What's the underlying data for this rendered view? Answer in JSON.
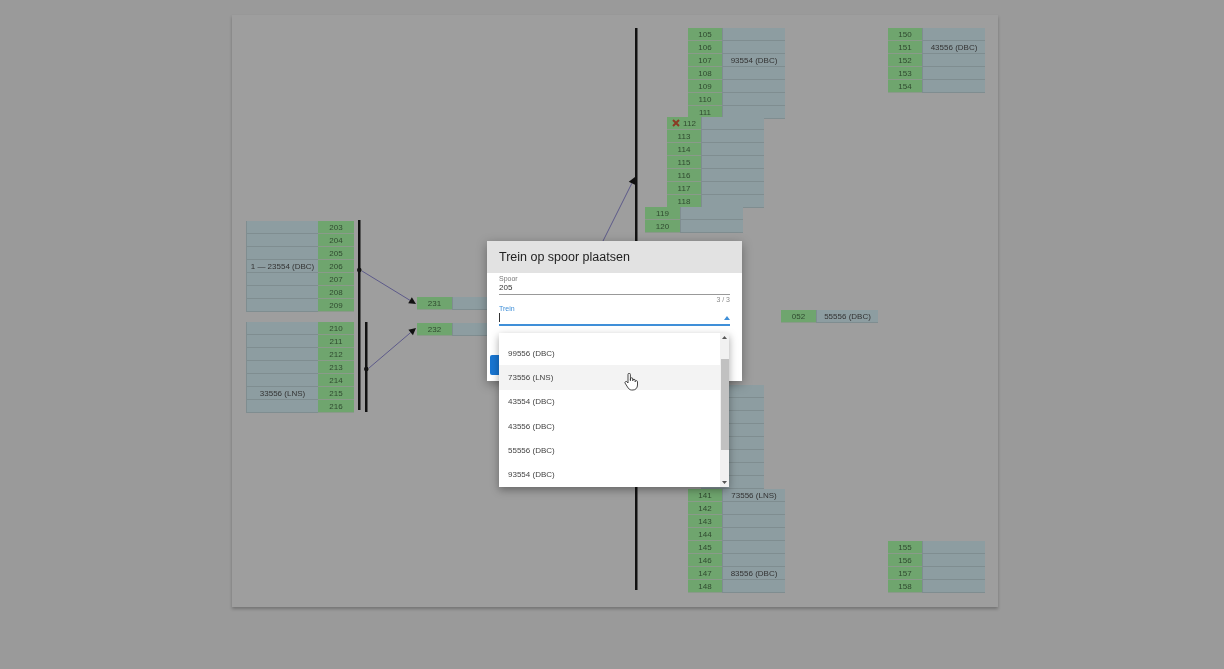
{
  "track_groups": [
    {
      "kind": "left",
      "tracks": [
        {
          "number": "203",
          "blocked": false
        },
        {
          "number": "204",
          "blocked": false
        },
        {
          "number": "205",
          "blocked": false
        },
        {
          "number": "206",
          "train": "1 — 23554 (DBC)",
          "blocked": false
        },
        {
          "number": "207",
          "blocked": false
        },
        {
          "number": "208",
          "blocked": false
        },
        {
          "number": "209",
          "blocked": false
        }
      ]
    },
    {
      "kind": "left",
      "tracks": [
        {
          "number": "210",
          "blocked": false
        },
        {
          "number": "211",
          "blocked": false
        },
        {
          "number": "212",
          "blocked": false
        },
        {
          "number": "213",
          "blocked": false
        },
        {
          "number": "214",
          "blocked": false
        },
        {
          "number": "215",
          "train": "33556 (LNS)",
          "blocked": false
        },
        {
          "number": "216",
          "blocked": false
        }
      ]
    },
    {
      "kind": "right",
      "tracks": [
        {
          "number": "231",
          "blocked": false
        }
      ]
    },
    {
      "kind": "right",
      "tracks": [
        {
          "number": "232",
          "blocked": false
        }
      ]
    },
    {
      "kind": "right",
      "tracks": [
        {
          "number": "105",
          "blocked": false
        },
        {
          "number": "106",
          "blocked": false
        },
        {
          "number": "107",
          "train": "93554 (DBC)",
          "blocked": false
        },
        {
          "number": "108",
          "blocked": false
        },
        {
          "number": "109",
          "blocked": false
        },
        {
          "number": "110",
          "blocked": false
        },
        {
          "number": "111",
          "blocked": false
        }
      ]
    },
    {
      "kind": "right",
      "tracks": [
        {
          "number": "112",
          "blocked": true
        },
        {
          "number": "113",
          "blocked": false
        },
        {
          "number": "114",
          "blocked": false
        },
        {
          "number": "115",
          "blocked": false
        },
        {
          "number": "116",
          "blocked": false
        },
        {
          "number": "117",
          "blocked": false
        },
        {
          "number": "118",
          "blocked": false
        }
      ]
    },
    {
      "kind": "right",
      "tracks": [
        {
          "number": "119",
          "blocked": false
        },
        {
          "number": "120",
          "blocked": false
        }
      ]
    },
    {
      "kind": "right",
      "tracks": [
        {
          "number": "141",
          "train": "73556 (LNS)",
          "blocked": false
        },
        {
          "number": "142",
          "blocked": false
        },
        {
          "number": "143",
          "blocked": false
        },
        {
          "number": "144",
          "blocked": false
        },
        {
          "number": "145",
          "blocked": false
        },
        {
          "number": "146",
          "blocked": false
        },
        {
          "number": "147",
          "train": "83556 (DBC)",
          "blocked": false
        },
        {
          "number": "148",
          "blocked": false
        }
      ]
    },
    {
      "kind": "right",
      "tracks": [
        {
          "number": "150",
          "blocked": false
        },
        {
          "number": "151",
          "train": "43556 (DBC)",
          "blocked": false
        },
        {
          "number": "152",
          "blocked": false
        },
        {
          "number": "153",
          "blocked": false
        },
        {
          "number": "154",
          "blocked": false
        }
      ]
    },
    {
      "kind": "right",
      "tracks": [
        {
          "number": "155",
          "blocked": false
        },
        {
          "number": "156",
          "blocked": false
        },
        {
          "number": "157",
          "blocked": false
        },
        {
          "number": "158",
          "blocked": false
        }
      ]
    },
    {
      "kind": "right",
      "tracks": [
        {
          "number": "052",
          "train": "55556 (DBC)",
          "blocked": false
        }
      ]
    }
  ],
  "dialog": {
    "title": "Trein op spoor plaatsen",
    "fields": [
      {
        "label": "Spoor",
        "value": "205",
        "counter": "3 / 3",
        "focused": false
      },
      {
        "label": "Trein",
        "focused": true
      }
    ],
    "dropdown": {
      "options": [
        {
          "label": "99556 (DBC)",
          "hovered": false
        },
        {
          "label": "73556 (LNS)",
          "hovered": true
        },
        {
          "label": "43554 (DBC)",
          "hovered": false
        },
        {
          "label": "43556 (DBC)",
          "hovered": false
        },
        {
          "label": "55556 (DBC)",
          "hovered": false
        },
        {
          "label": "93554 (DBC)",
          "hovered": false
        }
      ]
    }
  }
}
